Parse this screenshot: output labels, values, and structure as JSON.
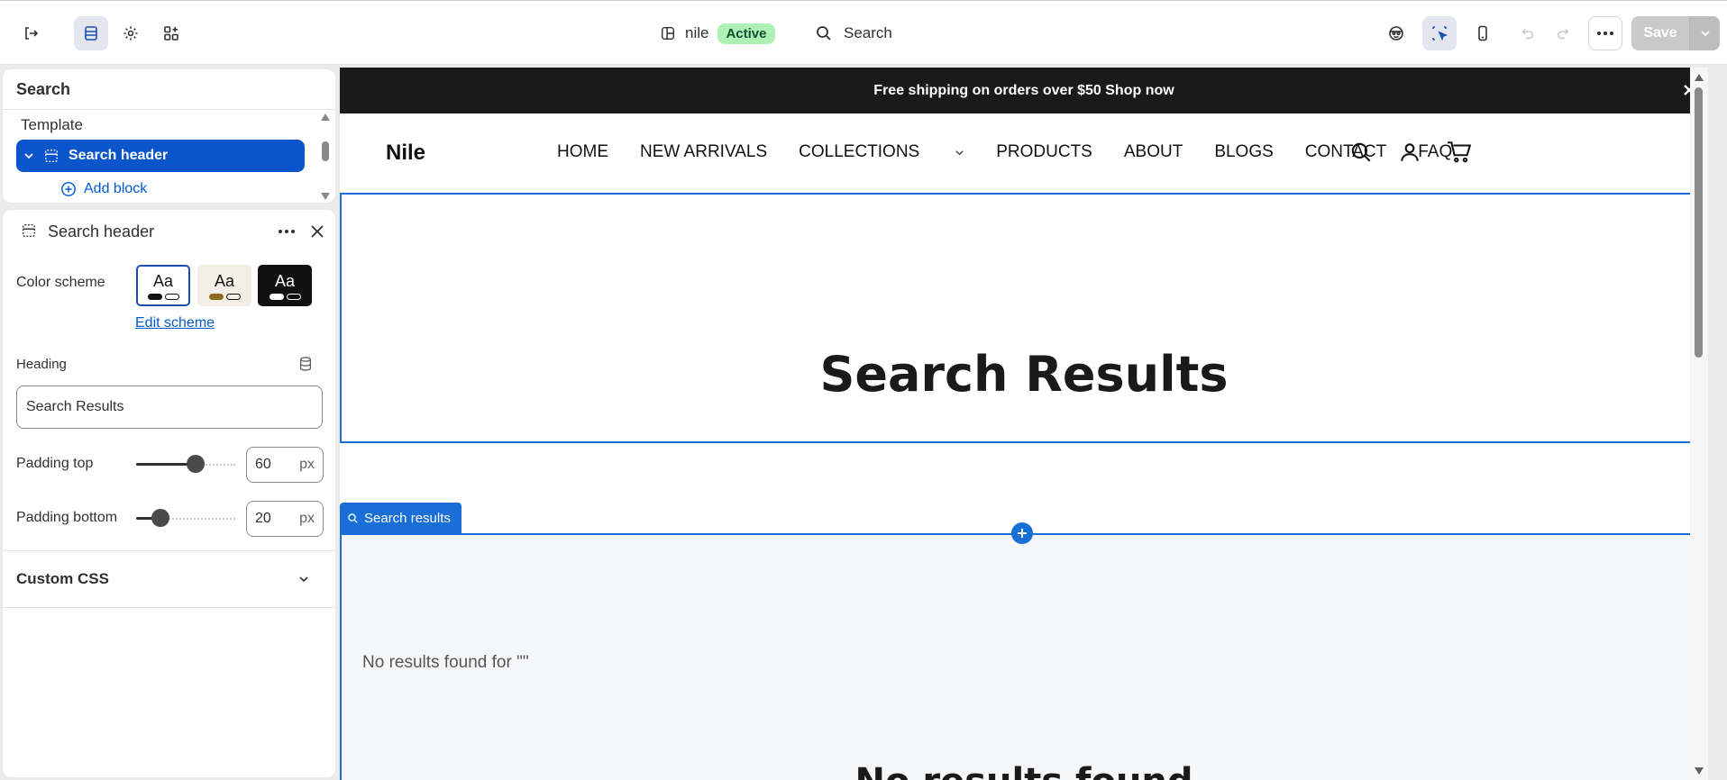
{
  "topbar": {
    "theme_name": "nile",
    "theme_status": "Active",
    "search_label": "Search",
    "save_label": "Save"
  },
  "sidebar": {
    "panel_title": "Search",
    "template_label": "Template",
    "selected_section": "Search header",
    "add_block_label": "Add block"
  },
  "settings": {
    "title": "Search header",
    "color_scheme_label": "Color scheme",
    "scheme_sample": [
      "Aa",
      "Aa",
      "Aa"
    ],
    "edit_scheme_label": "Edit scheme",
    "heading_label": "Heading",
    "heading_value": "Search Results",
    "padding_top_label": "Padding top",
    "padding_top_value": "60",
    "padding_bottom_label": "Padding bottom",
    "padding_bottom_value": "20",
    "unit": "px",
    "custom_css_label": "Custom CSS"
  },
  "preview": {
    "announcement": "Free shipping on orders over $50 Shop now",
    "logo": "Nile",
    "nav": [
      "HOME",
      "NEW ARRIVALS",
      "COLLECTIONS",
      "PRODUCTS",
      "ABOUT",
      "BLOGS",
      "CONTACT",
      "FAQ"
    ],
    "heading": "Search Results",
    "section_tag": "Search results",
    "no_results_for": "No results found for \"\"",
    "no_results": "No results found"
  },
  "colors": {
    "accent": "#0a55cc",
    "selection_outline": "#1a6fd6",
    "active_badge": "#aff0b5"
  }
}
